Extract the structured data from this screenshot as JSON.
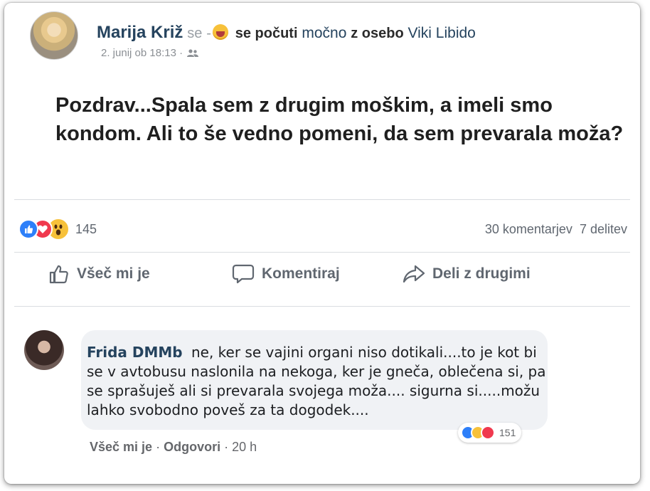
{
  "post": {
    "author": "Marija Križ",
    "feeling_prefix": "se",
    "feeling_separator": "-",
    "feeling_text": "se počuti",
    "feeling_word": "močno",
    "with_text": "z osebo",
    "tagged_person": "Viki Libido",
    "date": "2. junij ob 18:13 ·",
    "audience_icon": "friends-icon",
    "text": "Pozdrav...Spala sem z drugim moškim, a imeli smo kondom. Ali to še vedno pomeni, da sem prevarala moža?"
  },
  "stats": {
    "reaction_icons": [
      "like-reaction-icon",
      "love-reaction-icon",
      "wow-reaction-icon"
    ],
    "reaction_count": "145",
    "comments": "30 komentarjev",
    "shares": "7 delitev"
  },
  "actions": {
    "like": "Všeč mi je",
    "comment": "Komentiraj",
    "share": "Deli z drugimi"
  },
  "comment": {
    "author": "Frida DMMb",
    "text": "ne, ker se vajini organi niso dotikali....to je kot bi se v avtobusu naslonila na nekoga, ker je gneča, oblečena si, pa se sprašuješ ali si prevarala svojega moža.... sigurna si.....možu lahko svobodno poveš za ta dogodek....",
    "reaction_icons": [
      "like-reaction-icon",
      "haha-reaction-icon",
      "love-reaction-icon"
    ],
    "reaction_count": "151",
    "like_label": "Všeč mi je",
    "reply_label": "Odgovori",
    "time": "20 h",
    "meta_separator": "·"
  },
  "colors": {
    "name_blue": "#25435e",
    "like_blue": "#2d7ff9",
    "love_red": "#f0394e",
    "emoji_yellow": "#f7c13a",
    "muted_grey": "#606770"
  }
}
